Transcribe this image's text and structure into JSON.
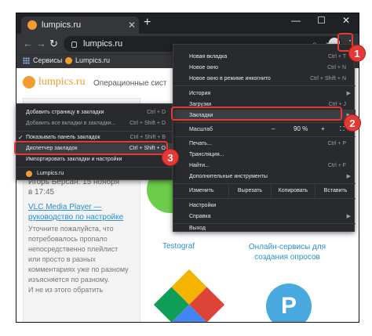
{
  "browser": {
    "tab_title": "lumpics.ru",
    "new_tab": "+",
    "window_controls": [
      "—",
      "☐",
      "✕"
    ],
    "url": "lumpics.ru",
    "bookmarks_bar": [
      {
        "label": "Сервисы",
        "icon": "apps-icon"
      },
      {
        "label": "Lumpics.ru",
        "icon": "site-favicon"
      }
    ]
  },
  "page": {
    "logo_text": "lumpics.ru",
    "subtitle": "Операционные сист",
    "author": "Игорь Берсан: 15 ноября в 17:45",
    "author_line1": "Игорь Берсан: 15 ноября",
    "author_line2": "в 17:45",
    "link_line1": "VLC Media Player —",
    "link_line2": "руководство по настройке",
    "body_lines": [
      "Уточните пожалуйста, что",
      "потребовалось пропало",
      "непосредственно плейлист",
      "или просто в разных",
      "комментариях уже по разному",
      "изъясняется по разному.",
      "И не из этого обратить"
    ],
    "card1_label": "Testograf",
    "card2_label": "Онлайн-сервисы для создания опросов",
    "card2_line1": "Онлайн-сервисы для",
    "card2_line2": "создания опросов",
    "card3_letter": "P"
  },
  "menu": {
    "new_tab": "Новая вкладка",
    "new_tab_sc": "Ctrl + T",
    "new_window": "Новое окно",
    "new_window_sc": "Ctrl + N",
    "incognito": "Новое окно в режиме инкогнито",
    "incognito_sc": "Ctrl + Shift + N",
    "history": "История",
    "downloads": "Загрузки",
    "downloads_sc": "Ctrl + J",
    "bookmarks": "Закладки",
    "zoom": "Масштаб",
    "zoom_minus": "–",
    "zoom_value": "90 %",
    "zoom_plus": "+",
    "print": "Печать...",
    "print_sc": "Ctrl + P",
    "cast": "Трансляция...",
    "find": "Найти...",
    "find_sc": "Ctrl + F",
    "more_tools": "Дополнительные инструменты",
    "edit": "Изменить",
    "cut": "Вырезать",
    "copy": "Копировать",
    "paste": "Вставить",
    "settings": "Настройки",
    "help": "Справка",
    "exit": "Выход"
  },
  "submenu": {
    "add_page": "Добавить страницу в закладки",
    "add_page_sc": "Ctrl + D",
    "add_all": "Добавить все вкладки в закладки...",
    "add_all_sc": "Ctrl + Shift + D",
    "show_bar": "Показывать панель закладок",
    "show_bar_sc": "Ctrl + Shift + B",
    "manager": "Диспетчер закладок",
    "manager_sc": "Ctrl + Shift + O",
    "import": "Импортировать закладки и настройки",
    "site": "Lumpics.ru"
  },
  "badges": [
    "1",
    "2",
    "3"
  ],
  "colors": {
    "accent_red": "#e53935",
    "brand_orange": "#f29b2f",
    "link_blue": "#2a8fd3"
  }
}
